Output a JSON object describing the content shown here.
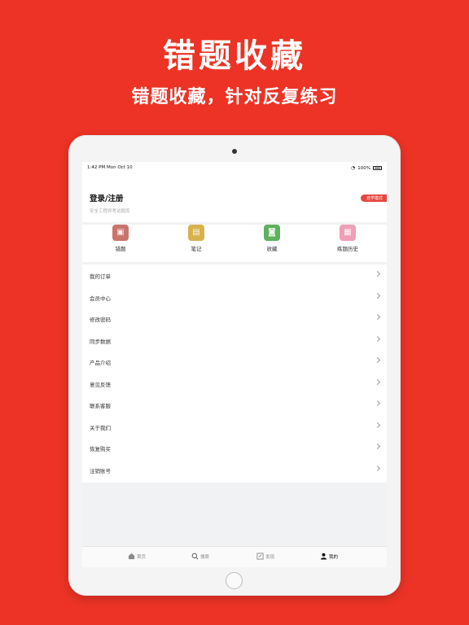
{
  "hero": {
    "title": "错题收藏",
    "subtitle": "错题收藏，针对反复练习"
  },
  "status_bar": {
    "time": "1:42 PM",
    "date": "Mon Oct 10",
    "battery": "100%"
  },
  "profile": {
    "login_title": "登录/注册",
    "subtitle": "安全工程师考试题库",
    "mode_badge": "自学模式"
  },
  "shortcuts": [
    {
      "label": "错题",
      "icon": "wrong-questions-icon",
      "color": "#c9756b"
    },
    {
      "label": "笔记",
      "icon": "notes-icon",
      "color": "#d6b24d"
    },
    {
      "label": "收藏",
      "icon": "favorites-icon",
      "color": "#5fb15f"
    },
    {
      "label": "练题历史",
      "icon": "history-icon",
      "color": "#ef9fb6"
    }
  ],
  "menu": [
    {
      "label": "我的订单"
    },
    {
      "label": "会员中心"
    },
    {
      "label": "修改密码"
    },
    {
      "label": "同步数据"
    },
    {
      "label": "产品介绍"
    },
    {
      "label": "意见反馈"
    },
    {
      "label": "联系客服"
    },
    {
      "label": "关于我们"
    },
    {
      "label": "恢复购买"
    },
    {
      "label": "注销账号"
    }
  ],
  "tabbar": [
    {
      "label": "首页",
      "icon": "home-icon"
    },
    {
      "label": "搜索",
      "icon": "search-icon"
    },
    {
      "label": "发现",
      "icon": "discover-icon"
    },
    {
      "label": "我的",
      "icon": "profile-icon",
      "active": true
    }
  ],
  "colors": {
    "background": "#ec3326",
    "accent": "#e8453c"
  }
}
